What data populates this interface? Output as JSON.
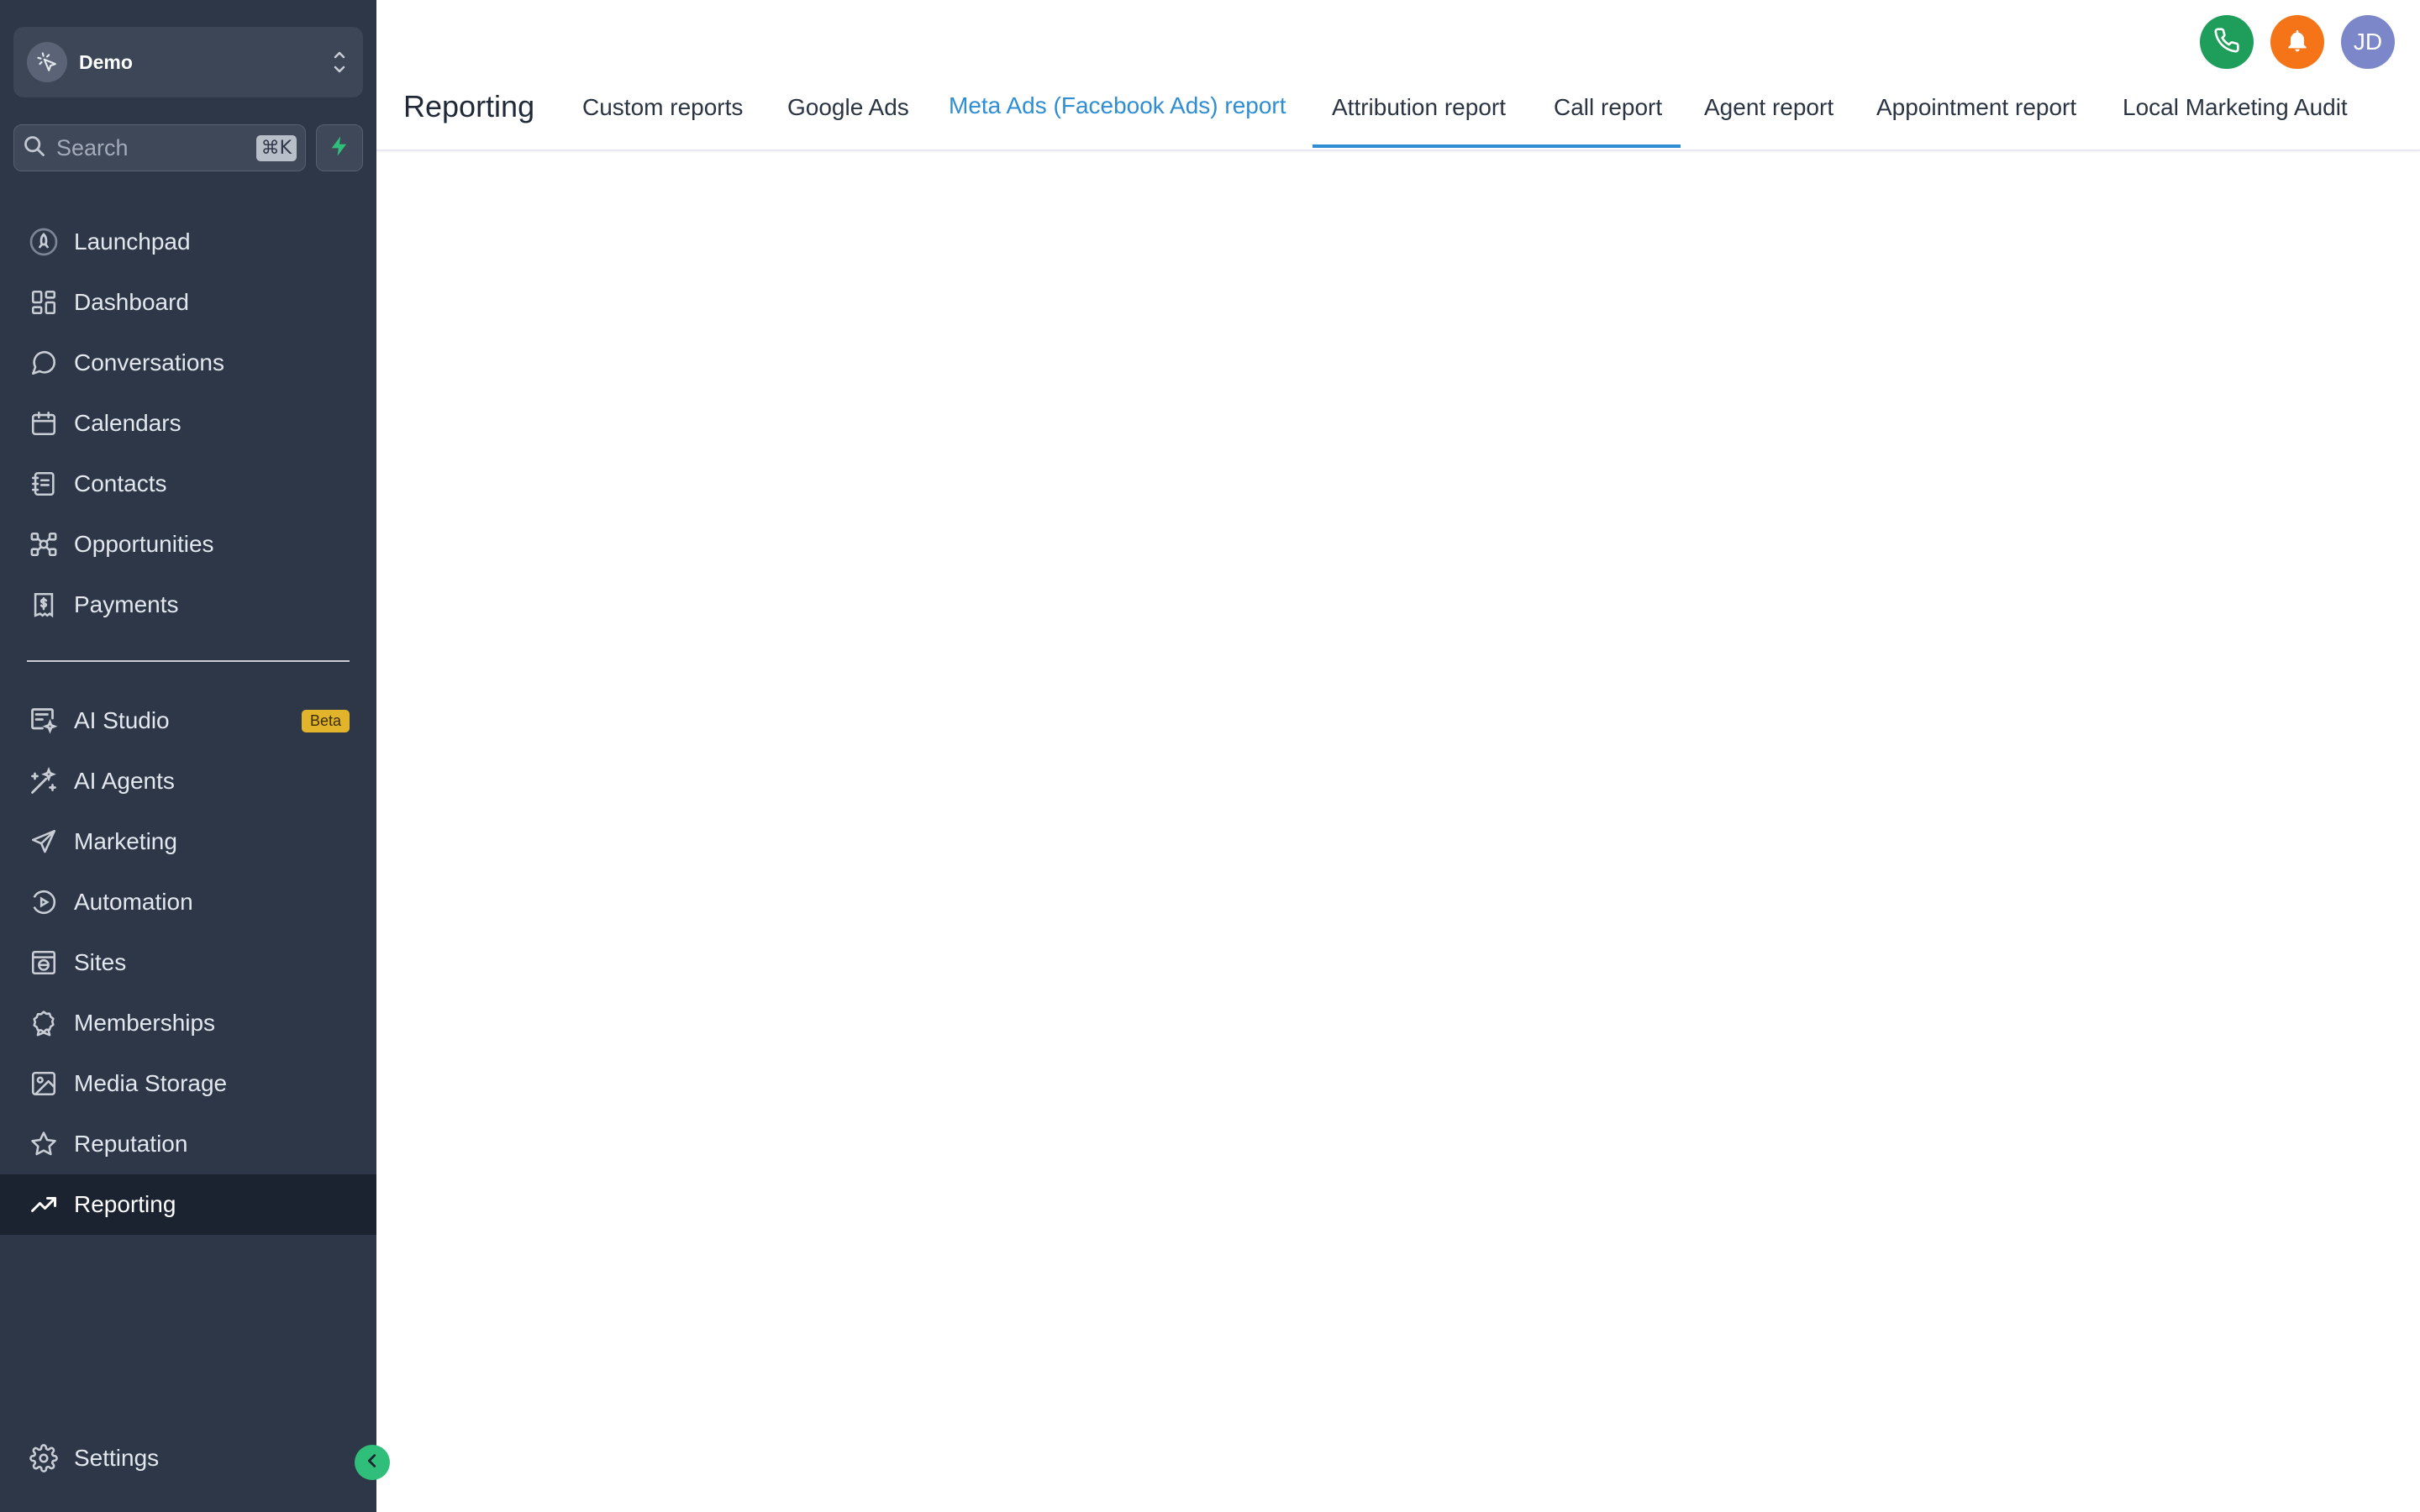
{
  "account": {
    "name": "Demo"
  },
  "search": {
    "placeholder": "Search",
    "shortcut": "⌘K"
  },
  "nav": {
    "launchpad": "Launchpad",
    "dashboard": "Dashboard",
    "conversations": "Conversations",
    "calendars": "Calendars",
    "contacts": "Contacts",
    "opportunities": "Opportunities",
    "payments": "Payments",
    "ai_studio": "AI Studio",
    "ai_studio_badge": "Beta",
    "ai_agents": "AI Agents",
    "marketing": "Marketing",
    "automation": "Automation",
    "sites": "Sites",
    "memberships": "Memberships",
    "media_storage": "Media Storage",
    "reputation": "Reputation",
    "reporting": "Reporting",
    "settings": "Settings"
  },
  "header": {
    "title": "Reporting",
    "tabs": [
      "Custom reports",
      "Google Ads",
      "Meta Ads (Facebook Ads) report",
      "Attribution report",
      "Call report",
      "Agent report",
      "Appointment report",
      "Local Marketing Audit"
    ],
    "active_tab": "Meta Ads (Facebook Ads) report",
    "avatar_initials": "JD"
  },
  "colors": {
    "sidebar_bg": "#2d3748",
    "accent": "#2f8ed3",
    "phone_button": "#1e9e5a",
    "bell_button": "#f57418",
    "avatar_bg": "#7b87c8",
    "beta_badge": "#e2b42b"
  },
  "icons": {
    "account": "cursor-click-icon",
    "search": "magnifier-icon",
    "quick_action": "lightning-icon",
    "phone": "phone-icon",
    "notifications": "bell-icon",
    "collapse": "chevron-left-icon"
  }
}
